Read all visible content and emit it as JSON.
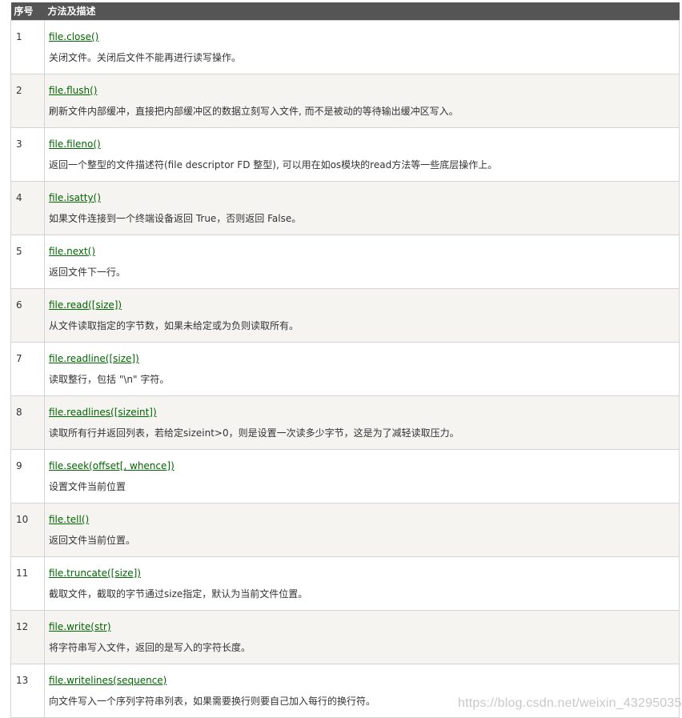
{
  "header": {
    "col_num": "序号",
    "col_method": "方法及描述"
  },
  "rows": [
    {
      "num": "1",
      "method": "file.close()",
      "desc": "关闭文件。关闭后文件不能再进行读写操作。"
    },
    {
      "num": "2",
      "method": "file.flush()",
      "desc": "刷新文件内部缓冲，直接把内部缓冲区的数据立刻写入文件, 而不是被动的等待输出缓冲区写入。"
    },
    {
      "num": "3",
      "method": "file.fileno()",
      "desc": "返回一个整型的文件描述符(file descriptor FD 整型), 可以用在如os模块的read方法等一些底层操作上。"
    },
    {
      "num": "4",
      "method": "file.isatty()",
      "desc": "如果文件连接到一个终端设备返回 True，否则返回 False。"
    },
    {
      "num": "5",
      "method": "file.next()",
      "desc": "返回文件下一行。"
    },
    {
      "num": "6",
      "method": "file.read([size])",
      "desc": "从文件读取指定的字节数，如果未给定或为负则读取所有。"
    },
    {
      "num": "7",
      "method": "file.readline([size])",
      "desc": "读取整行，包括 \"\\n\" 字符。"
    },
    {
      "num": "8",
      "method": "file.readlines([sizeint])",
      "desc": "读取所有行并返回列表，若给定sizeint>0，则是设置一次读多少字节，这是为了减轻读取压力。"
    },
    {
      "num": "9",
      "method": "file.seek(offset[, whence])",
      "desc": "设置文件当前位置"
    },
    {
      "num": "10",
      "method": "file.tell()",
      "desc": "返回文件当前位置。"
    },
    {
      "num": "11",
      "method": "file.truncate([size])",
      "desc": "截取文件，截取的字节通过size指定，默认为当前文件位置。"
    },
    {
      "num": "12",
      "method": "file.write(str)",
      "desc": "将字符串写入文件，返回的是写入的字符长度。"
    },
    {
      "num": "13",
      "method": "file.writelines(sequence)",
      "desc": "向文件写入一个序列字符串列表，如果需要换行则要自己加入每行的换行符。"
    }
  ],
  "watermark": "https://blog.csdn.net/weixin_43295035",
  "colors": {
    "header_bg": "#555555",
    "stripe_bg": "#f6f4f0",
    "link_color": "#006600"
  }
}
